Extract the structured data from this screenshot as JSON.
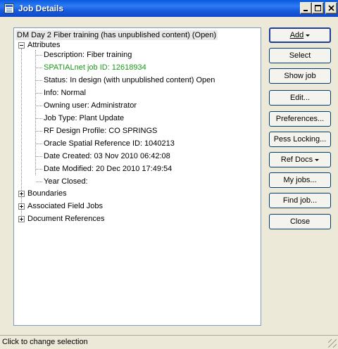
{
  "window": {
    "title": "Job Details"
  },
  "tree": {
    "root": "DM Day 2 Fiber training  (has unpublished content) (Open)",
    "attributes_label": "Attributes",
    "attributes": [
      {
        "text": "Description: Fiber training",
        "color": "#000000"
      },
      {
        "text": "SPATIALnet job ID: 12618934",
        "color": "#1a9a1a"
      },
      {
        "text": "Status:  In design (with unpublished content) Open",
        "color": "#000000"
      },
      {
        "text": "Info: Normal",
        "color": "#000000"
      },
      {
        "text": "Owning user: Administrator",
        "color": "#000000"
      },
      {
        "text": "Job Type: Plant Update",
        "color": "#000000"
      },
      {
        "text": "RF Design Profile: CO SPRINGS",
        "color": "#000000"
      },
      {
        "text": "Oracle Spatial Reference ID: 1040213",
        "color": "#000000"
      },
      {
        "text": "Date Created: 03 Nov 2010 06:42:08",
        "color": "#000000"
      },
      {
        "text": "Date Modified: 20 Dec 2010 17:49:54",
        "color": "#000000"
      },
      {
        "text": "Year Closed:",
        "color": "#000000"
      }
    ],
    "collapsed_nodes": [
      "Boundaries",
      "Associated Field Jobs",
      "Document References"
    ]
  },
  "buttons": {
    "add": "Add",
    "select": "Select",
    "show_job": "Show job",
    "edit": "Edit...",
    "preferences": "Preferences...",
    "pess_locking": "Pess Locking...",
    "ref_docs": "Ref Docs",
    "my_jobs": "My jobs...",
    "find_job": "Find job...",
    "close": "Close"
  },
  "status": {
    "text": "Click to change selection"
  }
}
